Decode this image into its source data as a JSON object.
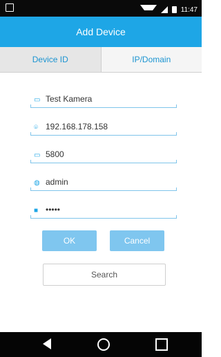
{
  "status": {
    "time": "11:47"
  },
  "app_bar": {
    "title": "Add Device"
  },
  "tabs": [
    {
      "label": "Device ID"
    },
    {
      "label": "IP/Domain"
    }
  ],
  "form": {
    "name": {
      "value": "Test Kamera"
    },
    "ip": {
      "value": "192.168.178.158"
    },
    "port": {
      "value": "5800"
    },
    "user": {
      "value": "admin"
    },
    "password": {
      "value": "•••••"
    }
  },
  "buttons": {
    "ok": "OK",
    "cancel": "Cancel",
    "search": "Search"
  },
  "colors": {
    "primary": "#1ea6e6",
    "button_fill": "#7fc6ef"
  },
  "icons": {
    "device": "device-icon",
    "location": "location-pin-icon",
    "port": "port-icon",
    "user": "user-icon",
    "lock": "lock-icon",
    "back": "back-icon",
    "home": "home-icon",
    "recent": "recent-apps-icon"
  }
}
